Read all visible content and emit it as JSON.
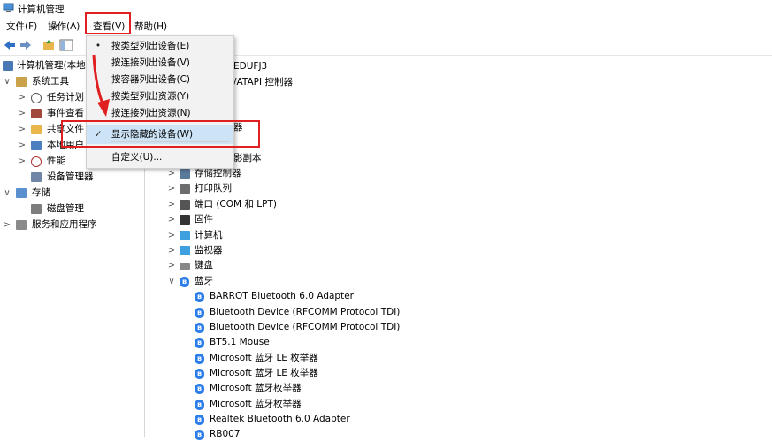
{
  "window": {
    "title": "计算机管理"
  },
  "menubar": {
    "items": [
      "文件(F)",
      "操作(A)",
      "查看(V)",
      "帮助(H)"
    ]
  },
  "view_menu": {
    "items": [
      {
        "label": "按类型列出设备(E)",
        "mark": "•"
      },
      {
        "label": "按连接列出设备(V)",
        "mark": ""
      },
      {
        "label": "按容器列出设备(C)",
        "mark": ""
      },
      {
        "label": "按类型列出资源(Y)",
        "mark": ""
      },
      {
        "label": "按连接列出资源(N)",
        "mark": ""
      },
      {
        "label": "显示隐藏的设备(W)",
        "mark": "✓"
      },
      {
        "label": "自定义(U)...",
        "mark": ""
      }
    ]
  },
  "left_tree": {
    "items": [
      {
        "label": "计算机管理(本地",
        "chev": ""
      },
      {
        "label": "系统工具",
        "chev": "∨"
      },
      {
        "label": "任务计划",
        "chev": ">"
      },
      {
        "label": "事件查看",
        "chev": ">"
      },
      {
        "label": "共享文件",
        "chev": ">"
      },
      {
        "label": "本地用户",
        "chev": ">"
      },
      {
        "label": "性能",
        "chev": ">"
      },
      {
        "label": "设备管理器",
        "chev": ""
      },
      {
        "label": "存储",
        "chev": "∨"
      },
      {
        "label": "磁盘管理",
        "chev": ""
      },
      {
        "label": "服务和应用程序",
        "chev": ">"
      }
    ]
  },
  "device_tree": {
    "partial_items": [
      {
        "label": "EDUFJ3"
      },
      {
        "label": "/ATAPI 控制器"
      },
      {
        "label": "器"
      },
      {
        "label": "影副本"
      }
    ],
    "categories": [
      {
        "label": "存储控制器",
        "chev": ">"
      },
      {
        "label": "打印队列",
        "chev": ">"
      },
      {
        "label": "端口 (COM 和 LPT)",
        "chev": ">"
      },
      {
        "label": "固件",
        "chev": ">"
      },
      {
        "label": "计算机",
        "chev": ">"
      },
      {
        "label": "监视器",
        "chev": ">"
      },
      {
        "label": "键盘",
        "chev": ">"
      },
      {
        "label": "蓝牙",
        "chev": "∨"
      }
    ],
    "bluetooth_devices": [
      "BARROT Bluetooth 6.0 Adapter",
      "Bluetooth Device (RFCOMM Protocol TDI)",
      "Bluetooth Device (RFCOMM Protocol TDI)",
      "BT5.1 Mouse",
      "Microsoft 蓝牙 LE 枚举器",
      "Microsoft 蓝牙 LE 枚举器",
      "Microsoft 蓝牙枚举器",
      "Microsoft 蓝牙枚举器",
      "Realtek Bluetooth 6.0 Adapter",
      "RB007"
    ]
  },
  "colors": {
    "highlight_red": "#e02020",
    "menu_hover": "#cde4f7",
    "bluetooth_blue": "#2b7de9"
  }
}
